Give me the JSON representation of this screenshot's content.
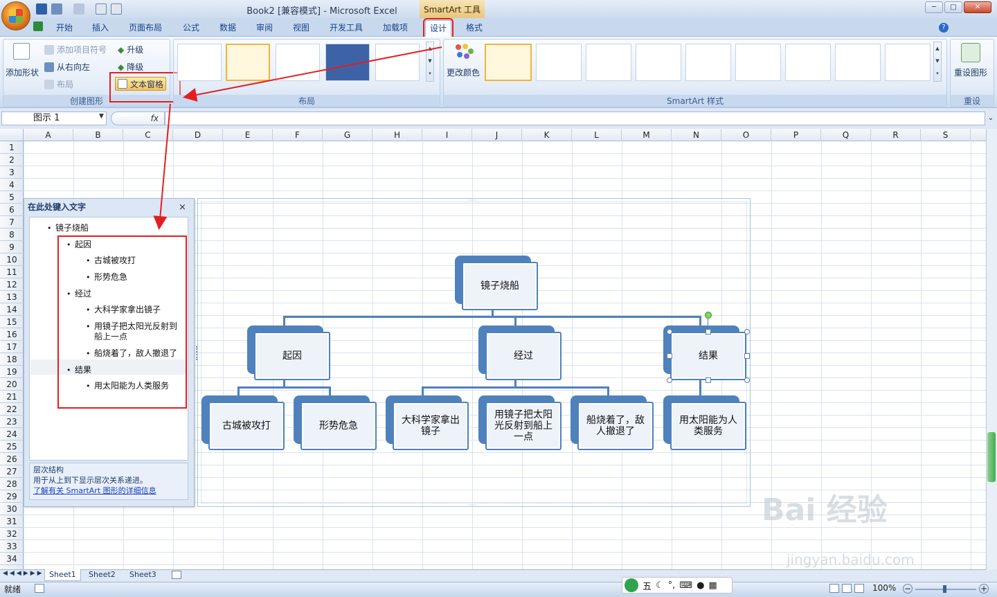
{
  "window": {
    "title": "Book2  [兼容模式] - Microsoft Excel",
    "context_tab": "SmartArt 工具",
    "controls": [
      "─",
      "□",
      "✕"
    ]
  },
  "tabs": [
    "开始",
    "插入",
    "页面布局",
    "公式",
    "数据",
    "审阅",
    "视图",
    "开发工具",
    "加载项",
    "设计",
    "格式"
  ],
  "active_tab": "设计",
  "ribbon": {
    "create_group": {
      "label": "创建图形",
      "add_shape": "添加形状",
      "add_bullet": "添加项目符号",
      "right_to_left": "从右向左",
      "layout": "布局",
      "promote": "升级",
      "demote": "降级",
      "text_pane": "文本窗格"
    },
    "layouts_group": {
      "label": "布局"
    },
    "styles_group": {
      "label": "SmartArt 样式",
      "change_colors": "更改颜色"
    },
    "reset_group": {
      "label": "重设",
      "reset_graphic": "重设图形"
    }
  },
  "formula_bar": {
    "name_box": "图示 1",
    "fx": "fx"
  },
  "columns": [
    "A",
    "B",
    "C",
    "D",
    "E",
    "F",
    "G",
    "H",
    "I",
    "J",
    "K",
    "L",
    "M",
    "N",
    "O",
    "P",
    "Q",
    "R",
    "S"
  ],
  "rows": [
    "1",
    "2",
    "3",
    "4",
    "5",
    "6",
    "7",
    "8",
    "9",
    "10",
    "11",
    "12",
    "13",
    "14",
    "15",
    "16",
    "17",
    "18",
    "19",
    "20",
    "21",
    "22",
    "23",
    "24",
    "25",
    "26",
    "27",
    "28",
    "29",
    "30",
    "31",
    "32",
    "33",
    "34"
  ],
  "text_pane": {
    "title": "在此处键入文字",
    "close": "×",
    "items": {
      "root": "镜子烧船",
      "cause": "起因",
      "cause_1": "古城被攻打",
      "cause_2": "形势危急",
      "process": "经过",
      "process_1": "大科学家拿出镜子",
      "process_2a": "用镜子把太阳光反射到",
      "process_2b": "船上一点",
      "process_3": "船烧着了，敌人撤退了",
      "result": "结果",
      "result_1": "用太阳能为人类服务"
    },
    "info_title": "层次结构",
    "info_desc": "用于从上到下显示层次关系递进。",
    "info_link": "了解有关 SmartArt 图形的详细信息"
  },
  "diagram": {
    "root": "镜子烧船",
    "level1": [
      "起因",
      "经过",
      "结果"
    ],
    "level2": [
      "古城被攻打",
      "形势危急",
      "大科学家拿出镜子",
      "用镜子把太阳光反射到船上一点",
      "船烧着了，敌人撤退了",
      "用太阳能为人类服务"
    ]
  },
  "sheet_tabs": [
    "Sheet1",
    "Sheet2",
    "Sheet3"
  ],
  "status": {
    "ready": "就绪",
    "zoom": "100%"
  },
  "ime": {
    "mode": "五"
  },
  "watermark": {
    "brand": "Bai 经验",
    "url": "jingyan.baidu.com"
  },
  "colors": {
    "accent": "#4f81bd",
    "highlight": "#e41e1e",
    "ribbon": "#dde8f6"
  }
}
